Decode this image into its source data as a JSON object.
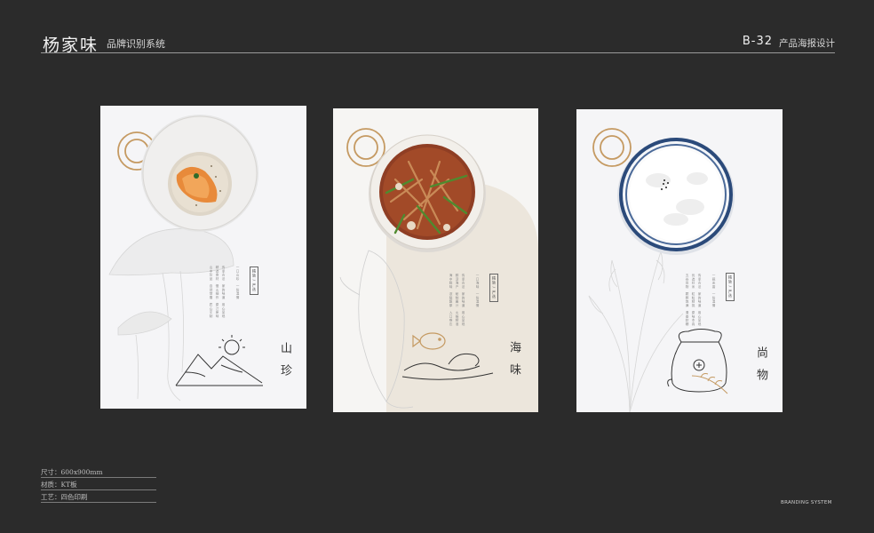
{
  "header": {
    "brand": "杨家味",
    "brand_sub": "品牌识别系统",
    "code": "B-32",
    "code_sub": "产品海报设计"
  },
  "posters": [
    {
      "title_top": "山",
      "title_bottom": "珍",
      "tag": "精致 / 严选",
      "image": "seafood-plate"
    },
    {
      "title_top": "海",
      "title_bottom": "味",
      "tag": "精致 / 严选",
      "image": "braised-fish-bowl"
    },
    {
      "title_top": "尚",
      "title_bottom": "物",
      "tag": "精致 / 严选",
      "image": "rice-bowl"
    }
  ],
  "specs": {
    "size": "尺寸：600x900mm",
    "material": "材质：KT板",
    "craft": "工艺：四色印刷"
  },
  "footer": {
    "brand_system": "BRANDING SYSTEM"
  },
  "colors": {
    "background": "#2b2b2b",
    "gold_ring": "#c59a62",
    "poster_bg": "#f5f5f7"
  }
}
